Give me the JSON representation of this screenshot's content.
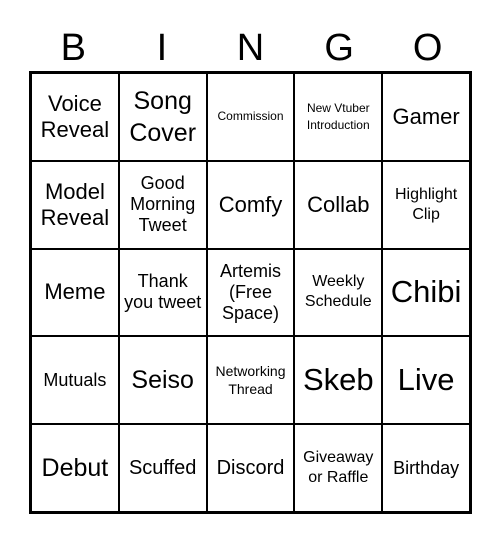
{
  "header": {
    "letters": [
      "B",
      "I",
      "N",
      "G",
      "O"
    ]
  },
  "cells": [
    {
      "text": "Voice Reveal",
      "size": "s-m"
    },
    {
      "text": "Song Cover",
      "size": "s-l"
    },
    {
      "text": "Commission",
      "size": "s-t"
    },
    {
      "text": "New Vtuber Introduction",
      "size": "s-t"
    },
    {
      "text": "Gamer",
      "size": "s-m"
    },
    {
      "text": "Model Reveal",
      "size": "s-m"
    },
    {
      "text": "Good Morning Tweet",
      "size": "s-s"
    },
    {
      "text": "Comfy",
      "size": "s-m"
    },
    {
      "text": "Collab",
      "size": "s-m"
    },
    {
      "text": "Highlight Clip",
      "size": "s-xs"
    },
    {
      "text": "Meme",
      "size": "s-m"
    },
    {
      "text": "Thank you tweet",
      "size": "s-s"
    },
    {
      "text": "Artemis (Free Space)",
      "size": "s-s"
    },
    {
      "text": "Weekly Schedule",
      "size": "s-xs"
    },
    {
      "text": "Chibi",
      "size": "s-xl"
    },
    {
      "text": "Mutuals",
      "size": "s-s"
    },
    {
      "text": "Seiso",
      "size": "s-l"
    },
    {
      "text": "Networking Thread",
      "size": "s-xxs"
    },
    {
      "text": "Skeb",
      "size": "s-xl"
    },
    {
      "text": "Live",
      "size": "s-xl"
    },
    {
      "text": "Debut",
      "size": "s-l"
    },
    {
      "text": "Scuffed",
      "size": "s-ms"
    },
    {
      "text": "Discord",
      "size": "s-ms"
    },
    {
      "text": "Giveaway or Raffle",
      "size": "s-xs"
    },
    {
      "text": "Birthday",
      "size": "s-s"
    }
  ]
}
